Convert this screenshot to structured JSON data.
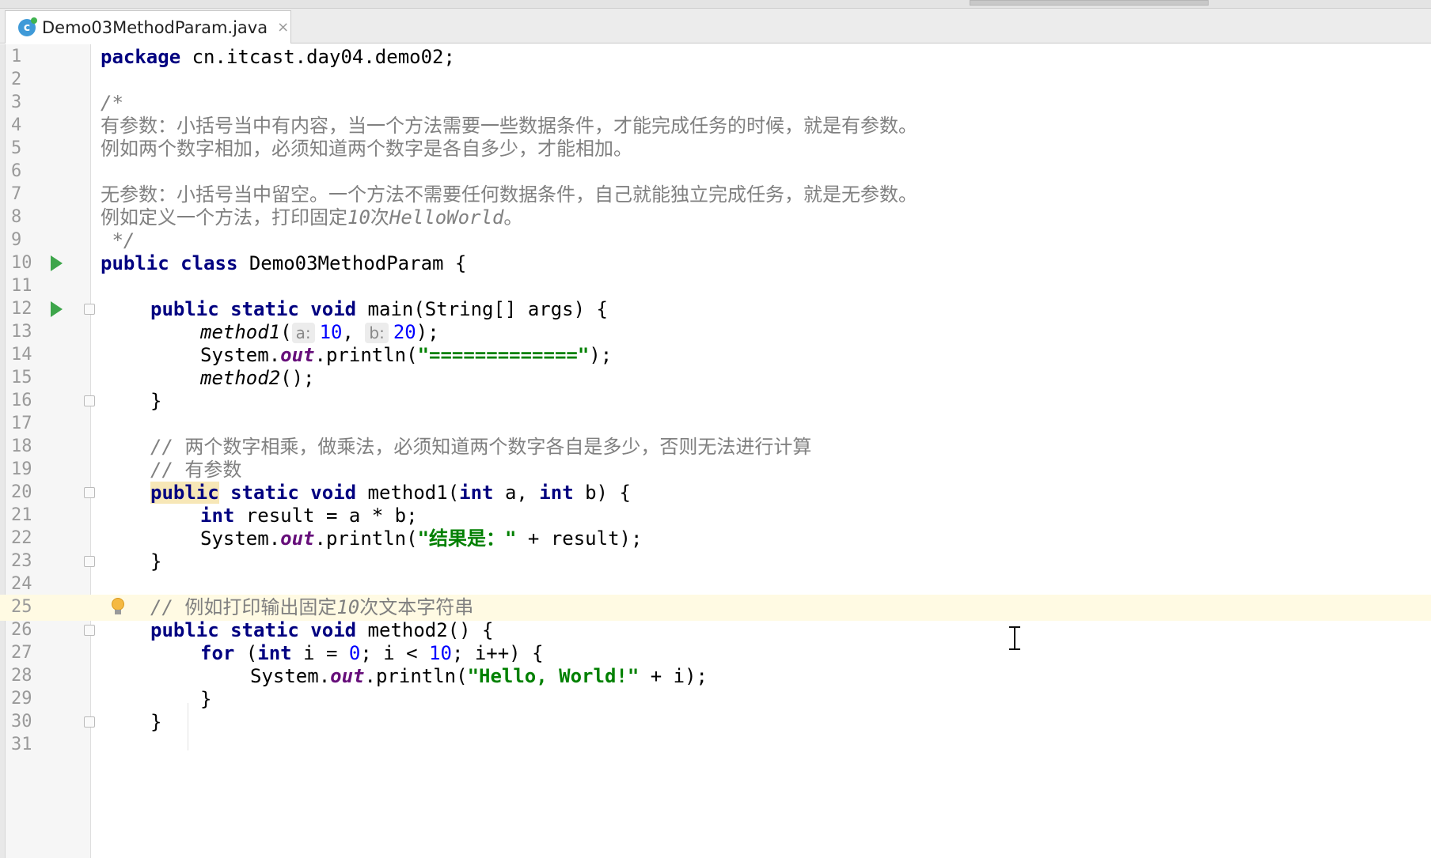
{
  "tab": {
    "filename": "Demo03MethodParam.java",
    "close_glyph": "×",
    "icon_letter": "c"
  },
  "lines": {
    "n1": "1",
    "n2": "2",
    "n3": "3",
    "n4": "4",
    "n5": "5",
    "n6": "6",
    "n7": "7",
    "n8": "8",
    "n9": "9",
    "n10": "10",
    "n11": "11",
    "n12": "12",
    "n13": "13",
    "n14": "14",
    "n15": "15",
    "n16": "16",
    "n17": "17",
    "n18": "18",
    "n19": "19",
    "n20": "20",
    "n21": "21",
    "n22": "22",
    "n23": "23",
    "n24": "24",
    "n25": "25",
    "n26": "26",
    "n27": "27",
    "n28": "28",
    "n29": "29",
    "n30": "30",
    "n31": "31"
  },
  "code": {
    "l1_kw": "package",
    "l1_rest": " cn.itcast.day04.demo02;",
    "l3": "/*",
    "l4": "有参数：小括号当中有内容，当一个方法需要一些数据条件，才能完成任务的时候，就是有参数。",
    "l5": "例如两个数字相加，必须知道两个数字是各自多少，才能相加。",
    "l7": "无参数：小括号当中留空。一个方法不需要任何数据条件，自己就能独立完成任务，就是无参数。",
    "l8_a": "例如定义一个方法，打印固定",
    "l8_b": "10",
    "l8_c": "次",
    "l8_d": "HelloWorld",
    "l8_e": "。",
    "l9": " */",
    "l10_kw": "public class",
    "l10_rest": " Demo03MethodParam {",
    "l12_kw": "public static void",
    "l12_rest": " main(String[] args) {",
    "l13_m": "method1",
    "l13_p": "(",
    "l13_ha": "a:",
    "l13_v1": "10",
    "l13_c": ", ",
    "l13_hb": "b:",
    "l13_v2": "20",
    "l13_e": ");",
    "l14_a": "System.",
    "l14_out": "out",
    "l14_b": ".println(",
    "l14_s": "\"=============\"",
    "l14_c": ");",
    "l15_m": "method2",
    "l15_e": "();",
    "l16": "}",
    "l18_a": "// ",
    "l18_b": "两个数字相乘，做乘法，必须知道两个数字各自是多少，否则无法进行计算",
    "l19_a": "// ",
    "l19_b": "有参数",
    "l20_kw1": "public",
    "l20_kw2": " static void",
    "l20_r1": " method1(",
    "l20_kw3": "int",
    "l20_r2": " a, ",
    "l20_kw4": "int",
    "l20_r3": " b) {",
    "l21_kw": "int",
    "l21_rest": " result = a * b;",
    "l22_a": "System.",
    "l22_out": "out",
    "l22_b": ".println(",
    "l22_s": "\"结果是：\"",
    "l22_c": " + result);",
    "l23": "}",
    "l25_a": "// ",
    "l25_b": "例如打印输出固定",
    "l25_c": "10",
    "l25_d": "次文本字符串",
    "l26_kw": "public static void",
    "l26_rest": " method2() {",
    "l27_kw1": "for",
    "l27_r1": " (",
    "l27_kw2": "int",
    "l27_r2": " i = ",
    "l27_n1": "0",
    "l27_r3": "; i < ",
    "l27_n2": "10",
    "l27_r4": "; i++) {",
    "l28_a": "System.",
    "l28_out": "out",
    "l28_b": ".println(",
    "l28_s": "\"Hello, World!\"",
    "l28_c": " + i);",
    "l29": "}",
    "l30": "}"
  },
  "colors": {
    "keyword": "#000080",
    "string": "#008000",
    "number": "#0000ff",
    "comment": "#808080",
    "field": "#660e7a",
    "highlight_line": "#fffae3"
  }
}
